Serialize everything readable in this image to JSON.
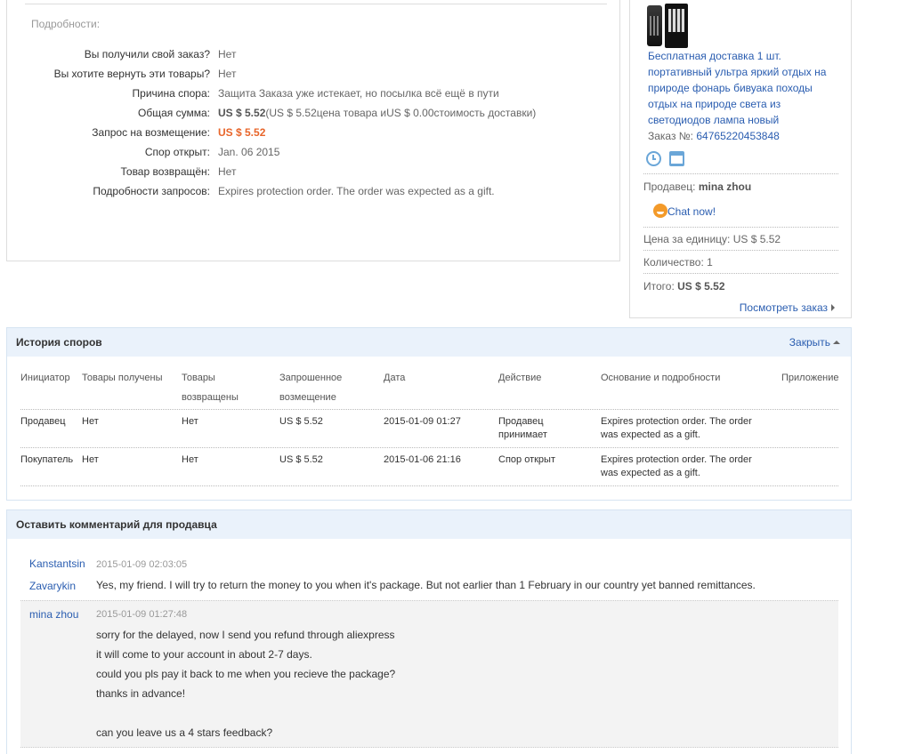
{
  "details": {
    "section_title": "Подробности:",
    "rows": [
      {
        "label": "Вы получили свой заказ?",
        "value": "Нет"
      },
      {
        "label": "Вы хотите вернуть эти товары?",
        "value": "Нет"
      },
      {
        "label": "Причина спора:",
        "value": "Защита Заказа уже истекает, но посылка всё ещё в пути"
      },
      {
        "label": "Общая сумма:",
        "value_bold": "US $ 5.52",
        "value": "(US $ 5.52цена товара иUS $ 0.00стоимость доставки)"
      },
      {
        "label": "Запрос на возмещение:",
        "value": "US $ 5.52"
      },
      {
        "label": "Спор открыт:",
        "value": "Jan. 06 2015"
      },
      {
        "label": "Товар возвращён:",
        "value": "Нет"
      },
      {
        "label": "Подробности запросов:",
        "value": "Expires protection order. The order was expected as a gift."
      }
    ]
  },
  "sidebar": {
    "product_title": "Бесплатная доставка 1 шт. портативный ультра яркий отдых на природе фонарь бивуака походы отдых на природе света из светодиодов лампа новый",
    "order_label": "Заказ №:",
    "order_number": "64765220453848",
    "seller_label": "Продавец:",
    "seller_name": "mina zhou",
    "chat_label": "Chat now!",
    "unit_price_label": "Цена за единицу:",
    "unit_price": "US $ 5.52",
    "qty_label": "Количество:",
    "qty": "1",
    "total_label": "Итого:",
    "total": "US $ 5.52",
    "view_order": "Посмотреть заказ"
  },
  "history": {
    "title": "История споров",
    "close": "Закрыть",
    "headers": [
      "Инициатор",
      "Товары получены",
      "Товары\nвозвращены",
      "Запрошенное\nвозмещение",
      "Дата",
      "Действие",
      "Основание и подробности",
      "Приложение"
    ],
    "rows": [
      {
        "initiator": "Продавец",
        "received": "Нет",
        "returned": "Нет",
        "amount": "US $ 5.52",
        "date": "2015-01-09 01:27",
        "action": "Продавец\nпринимает",
        "reason": "Expires protection order. The order\nwas expected as a gift.",
        "attachment": ""
      },
      {
        "initiator": "Покупатель",
        "received": "Нет",
        "returned": "Нет",
        "amount": "US $ 5.52",
        "date": "2015-01-06 21:16",
        "action": "Спор открыт",
        "reason": "Expires protection order. The order\nwas expected as a gift.",
        "attachment": ""
      }
    ]
  },
  "comments": {
    "title": "Оставить комментарий для продавца",
    "items": [
      {
        "author_line1": "Kanstantsin",
        "author_line2": "Zavarykin",
        "date": "2015-01-09 02:03:05",
        "lines": [
          "Yes, my friend. I will try to return the money to you when it's package. But not earlier than 1 February in our country yet banned remittances."
        ]
      },
      {
        "author_line1": "mina zhou",
        "author_line2": "",
        "date": "2015-01-09 01:27:48",
        "lines": [
          "sorry for the delayed, now I send you refund through aliexpress",
          "it will come to your account in about 2-7 days.",
          "could you pls pay it back to me when you recieve the package?",
          "thanks in advance!",
          "",
          "can you leave us a 4 stars feedback?"
        ]
      }
    ]
  }
}
